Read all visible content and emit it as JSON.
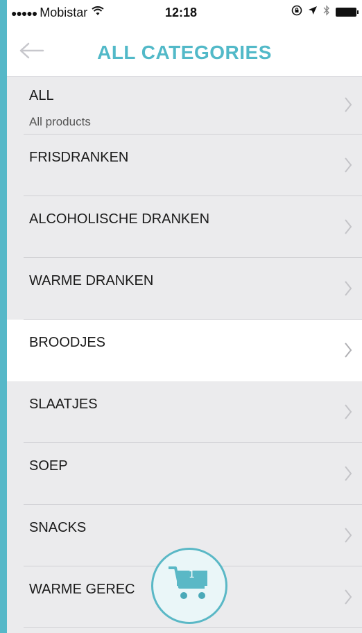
{
  "status_bar": {
    "signal_dots": "●●●●●",
    "carrier": "Mobistar",
    "time": "12:18"
  },
  "nav": {
    "title": "ALL CATEGORIES"
  },
  "categories": [
    {
      "label": "ALL",
      "subtitle": "All products"
    },
    {
      "label": "FRISDRANKEN"
    },
    {
      "label": "ALCOHOLISCHE DRANKEN"
    },
    {
      "label": "WARME DRANKEN"
    },
    {
      "label": "BROODJES",
      "selected": true
    },
    {
      "label": "SLAATJES"
    },
    {
      "label": "SOEP"
    },
    {
      "label": "SNACKS"
    },
    {
      "label": "WARME GEREC"
    }
  ],
  "cart": {
    "count": "1"
  },
  "colors": {
    "accent": "#52b9c8",
    "list_background": "#ebebed",
    "highlight_row": "#ffffff"
  }
}
